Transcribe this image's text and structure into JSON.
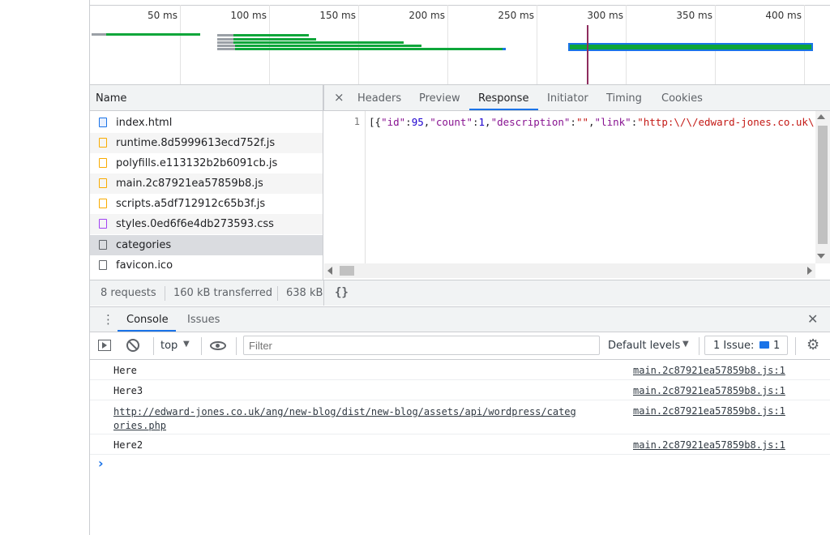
{
  "overview": {
    "ticks": [
      "50 ms",
      "100 ms",
      "150 ms",
      "200 ms",
      "250 ms",
      "300 ms",
      "350 ms",
      "400 ms"
    ]
  },
  "name_panel": {
    "header": "Name",
    "files": [
      {
        "name": "index.html",
        "icon": "document-icon",
        "color": "#1a73e8"
      },
      {
        "name": "runtime.8d5999613ecd752f.js",
        "icon": "script-icon",
        "color": "#f9ab00"
      },
      {
        "name": "polyfills.e113132b2b6091cb.js",
        "icon": "script-icon",
        "color": "#f9ab00"
      },
      {
        "name": "main.2c87921ea57859b8.js",
        "icon": "script-icon",
        "color": "#f9ab00"
      },
      {
        "name": "scripts.a5df712912c65b3f.js",
        "icon": "script-icon",
        "color": "#f9ab00"
      },
      {
        "name": "styles.0ed6f6e4db273593.css",
        "icon": "stylesheet-icon",
        "color": "#a142f4"
      },
      {
        "name": "categories",
        "icon": "fetch-icon",
        "color": "#5f6368"
      },
      {
        "name": "favicon.ico",
        "icon": "file-icon",
        "color": "#5f6368"
      }
    ],
    "status": {
      "requests": "8 requests",
      "transferred": "160 kB transferred",
      "resources": "638 kB"
    }
  },
  "response_panel": {
    "close": "×",
    "tabs": [
      "Headers",
      "Preview",
      "Response",
      "Initiator",
      "Timing",
      "Cookies"
    ],
    "active_tab": "Response",
    "line_number": "1",
    "pretty_print": "{}"
  },
  "drawer": {
    "menu": "⋮",
    "tabs": [
      "Console",
      "Issues"
    ],
    "active_tab": "Console",
    "close": "✕",
    "context": "top",
    "filter_placeholder": "Filter",
    "levels": "Default levels",
    "issues": "1 Issue:",
    "issues_count": "1"
  },
  "console": {
    "logs": [
      {
        "msg": "Here",
        "src": "main.2c87921ea57859b8.js:1"
      },
      {
        "msg": "Here3",
        "src": "main.2c87921ea57859b8.js:1"
      },
      {
        "msg": "http://edward-jones.co.uk/ang/new-blog/dist/new-blog/assets/api/wordpress/categ\nories.php",
        "src": "main.2c87921ea57859b8.js:1"
      },
      {
        "msg": "Here2",
        "src": "main.2c87921ea57859b8.js:1"
      }
    ],
    "prompt": "›"
  },
  "colors": {
    "accent": "#1a73e8",
    "green": "#0ea63a",
    "marker": "#8e2d5e"
  }
}
